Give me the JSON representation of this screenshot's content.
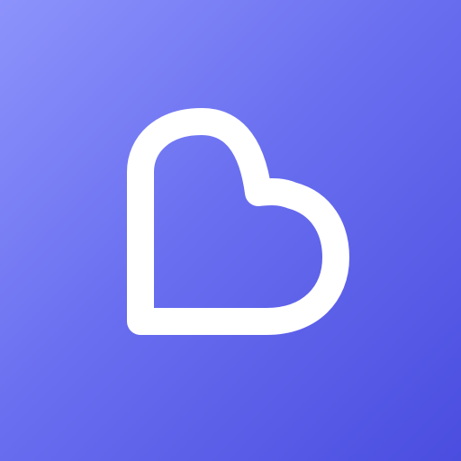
{
  "icon": {
    "name": "heart-b-logo",
    "colors": {
      "gradient_start": "#8d93fb",
      "gradient_mid": "#6a6ff0",
      "gradient_end": "#4a4ddf",
      "mark": "#ffffff"
    }
  }
}
